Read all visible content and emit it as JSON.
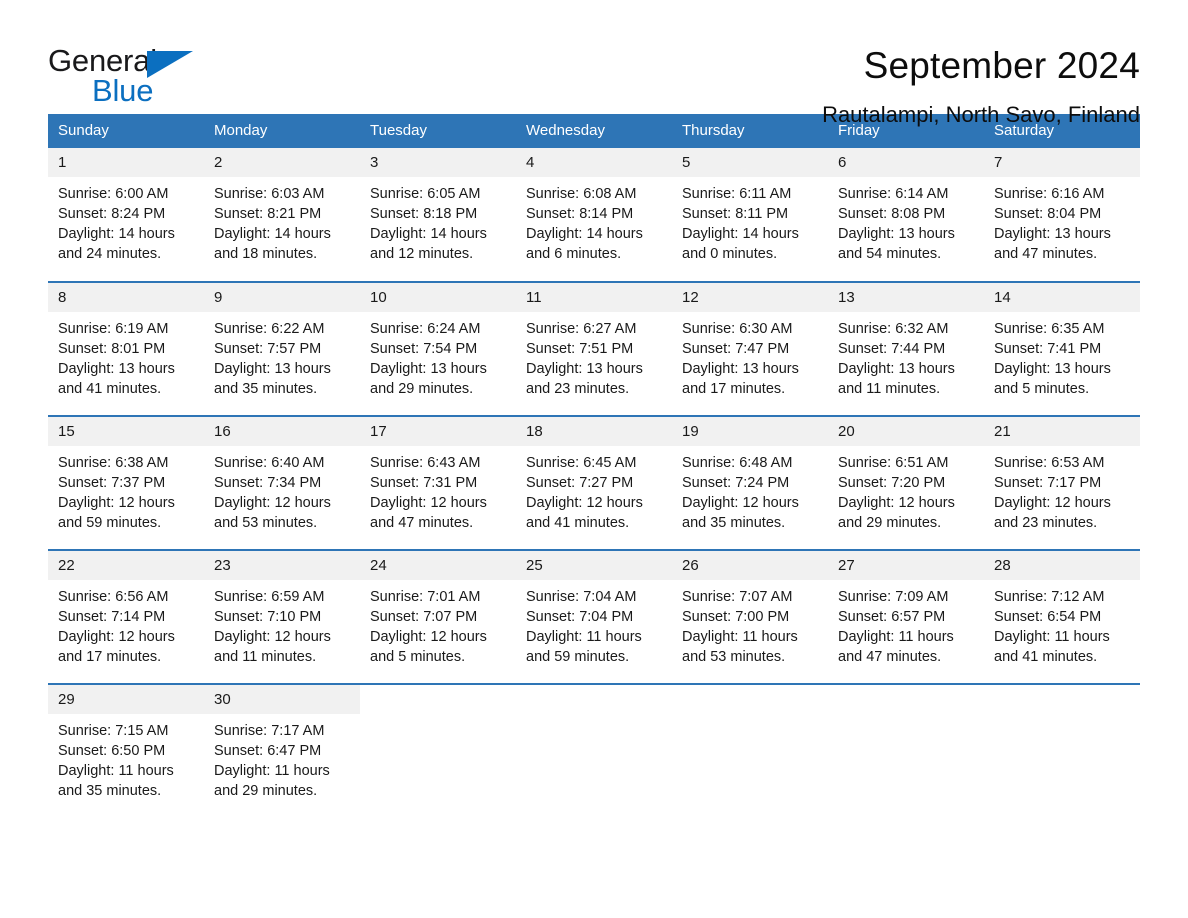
{
  "brand": {
    "name_top": "General",
    "name_bottom": "Blue",
    "accent_color": "#0b6fc0"
  },
  "header": {
    "title": "September 2024",
    "subtitle": "Rautalampi, North Savo, Finland"
  },
  "calendar": {
    "header_bg": "#2e75b6",
    "daynum_bg": "#f1f1f1",
    "weekdays": [
      "Sunday",
      "Monday",
      "Tuesday",
      "Wednesday",
      "Thursday",
      "Friday",
      "Saturday"
    ],
    "weeks": [
      [
        {
          "day": "1",
          "info": "Sunrise: 6:00 AM\nSunset: 8:24 PM\nDaylight: 14 hours\nand 24 minutes."
        },
        {
          "day": "2",
          "info": "Sunrise: 6:03 AM\nSunset: 8:21 PM\nDaylight: 14 hours\nand 18 minutes."
        },
        {
          "day": "3",
          "info": "Sunrise: 6:05 AM\nSunset: 8:18 PM\nDaylight: 14 hours\nand 12 minutes."
        },
        {
          "day": "4",
          "info": "Sunrise: 6:08 AM\nSunset: 8:14 PM\nDaylight: 14 hours\nand 6 minutes."
        },
        {
          "day": "5",
          "info": "Sunrise: 6:11 AM\nSunset: 8:11 PM\nDaylight: 14 hours\nand 0 minutes."
        },
        {
          "day": "6",
          "info": "Sunrise: 6:14 AM\nSunset: 8:08 PM\nDaylight: 13 hours\nand 54 minutes."
        },
        {
          "day": "7",
          "info": "Sunrise: 6:16 AM\nSunset: 8:04 PM\nDaylight: 13 hours\nand 47 minutes."
        }
      ],
      [
        {
          "day": "8",
          "info": "Sunrise: 6:19 AM\nSunset: 8:01 PM\nDaylight: 13 hours\nand 41 minutes."
        },
        {
          "day": "9",
          "info": "Sunrise: 6:22 AM\nSunset: 7:57 PM\nDaylight: 13 hours\nand 35 minutes."
        },
        {
          "day": "10",
          "info": "Sunrise: 6:24 AM\nSunset: 7:54 PM\nDaylight: 13 hours\nand 29 minutes."
        },
        {
          "day": "11",
          "info": "Sunrise: 6:27 AM\nSunset: 7:51 PM\nDaylight: 13 hours\nand 23 minutes."
        },
        {
          "day": "12",
          "info": "Sunrise: 6:30 AM\nSunset: 7:47 PM\nDaylight: 13 hours\nand 17 minutes."
        },
        {
          "day": "13",
          "info": "Sunrise: 6:32 AM\nSunset: 7:44 PM\nDaylight: 13 hours\nand 11 minutes."
        },
        {
          "day": "14",
          "info": "Sunrise: 6:35 AM\nSunset: 7:41 PM\nDaylight: 13 hours\nand 5 minutes."
        }
      ],
      [
        {
          "day": "15",
          "info": "Sunrise: 6:38 AM\nSunset: 7:37 PM\nDaylight: 12 hours\nand 59 minutes."
        },
        {
          "day": "16",
          "info": "Sunrise: 6:40 AM\nSunset: 7:34 PM\nDaylight: 12 hours\nand 53 minutes."
        },
        {
          "day": "17",
          "info": "Sunrise: 6:43 AM\nSunset: 7:31 PM\nDaylight: 12 hours\nand 47 minutes."
        },
        {
          "day": "18",
          "info": "Sunrise: 6:45 AM\nSunset: 7:27 PM\nDaylight: 12 hours\nand 41 minutes."
        },
        {
          "day": "19",
          "info": "Sunrise: 6:48 AM\nSunset: 7:24 PM\nDaylight: 12 hours\nand 35 minutes."
        },
        {
          "day": "20",
          "info": "Sunrise: 6:51 AM\nSunset: 7:20 PM\nDaylight: 12 hours\nand 29 minutes."
        },
        {
          "day": "21",
          "info": "Sunrise: 6:53 AM\nSunset: 7:17 PM\nDaylight: 12 hours\nand 23 minutes."
        }
      ],
      [
        {
          "day": "22",
          "info": "Sunrise: 6:56 AM\nSunset: 7:14 PM\nDaylight: 12 hours\nand 17 minutes."
        },
        {
          "day": "23",
          "info": "Sunrise: 6:59 AM\nSunset: 7:10 PM\nDaylight: 12 hours\nand 11 minutes."
        },
        {
          "day": "24",
          "info": "Sunrise: 7:01 AM\nSunset: 7:07 PM\nDaylight: 12 hours\nand 5 minutes."
        },
        {
          "day": "25",
          "info": "Sunrise: 7:04 AM\nSunset: 7:04 PM\nDaylight: 11 hours\nand 59 minutes."
        },
        {
          "day": "26",
          "info": "Sunrise: 7:07 AM\nSunset: 7:00 PM\nDaylight: 11 hours\nand 53 minutes."
        },
        {
          "day": "27",
          "info": "Sunrise: 7:09 AM\nSunset: 6:57 PM\nDaylight: 11 hours\nand 47 minutes."
        },
        {
          "day": "28",
          "info": "Sunrise: 7:12 AM\nSunset: 6:54 PM\nDaylight: 11 hours\nand 41 minutes."
        }
      ],
      [
        {
          "day": "29",
          "info": "Sunrise: 7:15 AM\nSunset: 6:50 PM\nDaylight: 11 hours\nand 35 minutes."
        },
        {
          "day": "30",
          "info": "Sunrise: 7:17 AM\nSunset: 6:47 PM\nDaylight: 11 hours\nand 29 minutes."
        },
        {
          "day": "",
          "info": ""
        },
        {
          "day": "",
          "info": ""
        },
        {
          "day": "",
          "info": ""
        },
        {
          "day": "",
          "info": ""
        },
        {
          "day": "",
          "info": ""
        }
      ]
    ]
  }
}
